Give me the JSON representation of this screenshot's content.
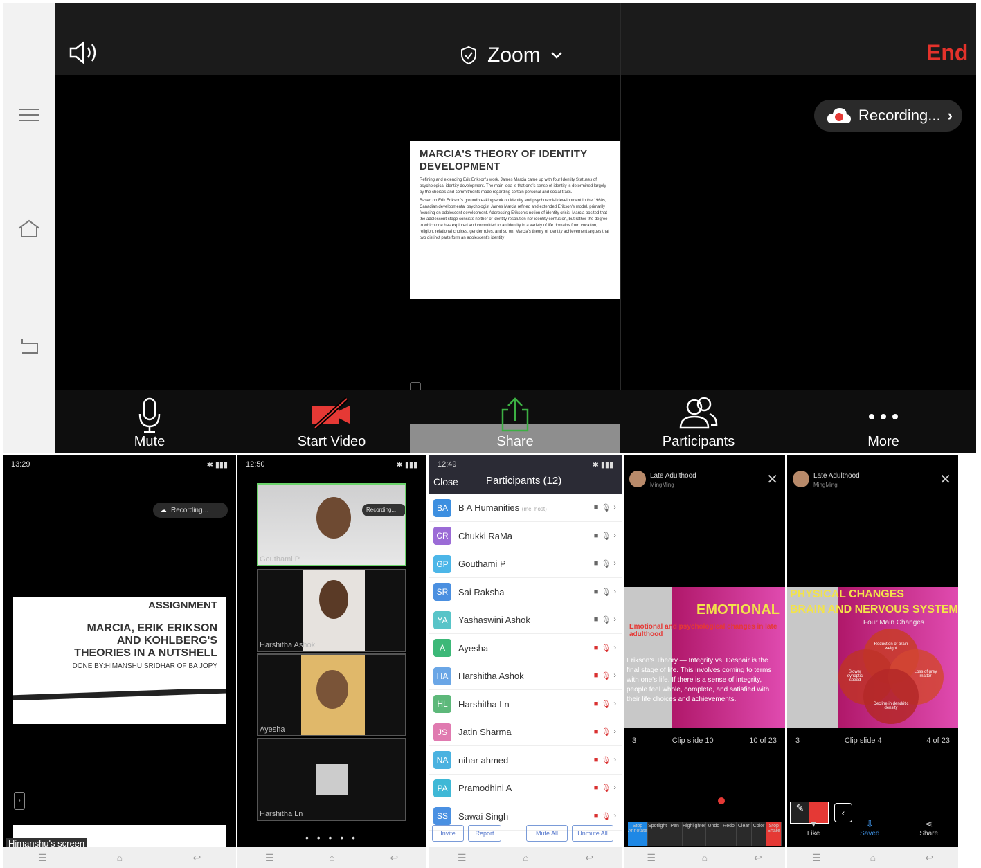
{
  "zoom": {
    "title": "Zoom",
    "end_label": "End",
    "recording_label": "Recording...",
    "shared_doc": {
      "title": "MARCIA'S THEORY OF IDENTITY DEVELOPMENT",
      "para1": "Refining and extending Erik Erikson's work, James Marcia came up with four Identity Statuses of psychological identity development. The main idea is that one's sense of identity is determined largely by the choices and commitments made regarding certain personal and social traits.",
      "para2": "Based on Erik Erikson's groundbreaking work on identity and psychosocial development in the 1960s, Canadian developmental psychologist James Marcia refined and extended Erikson's model, primarily focusing on adolescent development. Addressing Erikson's notion of identity crisis, Marcia posited that the adolescent stage consists neither of identity resolution nor identity confusion, but rather the degree to which one has explored and committed to an identity in a variety of life domains from vocation, religion, relational choices, gender roles, and so on. Marcia's theory of identity achievement argues that two distinct parts form an adolescent's identity"
    },
    "toolbar": {
      "mute": "Mute",
      "start_video": "Start Video",
      "share": "Share",
      "participants": "Participants",
      "more": "More"
    }
  },
  "phone1": {
    "time": "13:29",
    "recording_label": "Recording...",
    "slide_l1": "ASSIGNMENT",
    "slide_l2a": "MARCIA, ERIK ERIKSON",
    "slide_l2b": "AND KOHLBERG'S",
    "slide_l2c": "THEORIES IN A NUTSHELL",
    "slide_l3": "DONE BY:HIMANSHU SRIDHAR OF BA JOPY",
    "screen_label": "Himanshu's screen"
  },
  "phone2": {
    "time": "12:50",
    "recording_label": "Recording...",
    "tiles": [
      "Gouthami P",
      "Harshitha Ashok",
      "Ayesha",
      "Harshitha Ln"
    ]
  },
  "phone3": {
    "time": "12:49",
    "close_label": "Close",
    "title": "Participants (12)",
    "host_tag": "(me, host)",
    "participants": [
      {
        "initials": "BA",
        "name": "B A Humanities",
        "color": "#3d8fe0"
      },
      {
        "initials": "CR",
        "name": "Chukki RaMa",
        "color": "#9b6bd6"
      },
      {
        "initials": "GP",
        "name": "Gouthami P",
        "color": "#4cb6e8"
      },
      {
        "initials": "SR",
        "name": "Sai Raksha",
        "color": "#4a8fe0"
      },
      {
        "initials": "YA",
        "name": "Yashaswini Ashok",
        "color": "#58c4c8"
      },
      {
        "initials": "A",
        "name": "Ayesha",
        "color": "#3cb878"
      },
      {
        "initials": "HA",
        "name": "Harshitha Ashok",
        "color": "#6aa6e6"
      },
      {
        "initials": "HL",
        "name": "Harshitha Ln",
        "color": "#5db87a"
      },
      {
        "initials": "JS",
        "name": "Jatin Sharma",
        "color": "#e07ab0"
      },
      {
        "initials": "NA",
        "name": "nihar ahmed",
        "color": "#4ab2e0"
      },
      {
        "initials": "PA",
        "name": "Pramodhini A",
        "color": "#3fb8d6"
      },
      {
        "initials": "SS",
        "name": "Sawai Singh",
        "color": "#4a90e2"
      }
    ],
    "actions": [
      "Invite",
      "Report",
      "Mute All",
      "Unmute All"
    ]
  },
  "phone4": {
    "title": "Late Adulthood",
    "sub": "MingMing",
    "slide_heading": "EMOTIONAL",
    "slide_line1": "Emotional and psychological changes in late adulthood",
    "slide_text": "Erikson's Theory — Integrity vs. Despair is the final stage of life. This involves coming to terms with one's life. If there is a sense of integrity, people feel whole, complete, and satisfied with their life choices and achievements.",
    "count_left": "3",
    "clip_label": "Clip slide 10",
    "page": "10 of 23",
    "tools": [
      "Stop Annotate",
      "Spotlight",
      "Pen",
      "Highlighter",
      "Undo",
      "Redo",
      "Clear",
      "Color",
      "Stop Share"
    ]
  },
  "phone5": {
    "title": "Late Adulthood",
    "sub": "MingMing",
    "slide_heading1": "PHYSICAL CHANGES",
    "slide_heading2": "BRAIN AND NERVOUS SYSTEM",
    "slide_sub": "Four Main Changes",
    "venn": [
      "Reduction of brain weight",
      "Slower synaptic speed",
      "Loss of grey matter",
      "Decline in dendritic density"
    ],
    "count_left": "3",
    "clip_label": "Clip slide 4",
    "page": "4 of 23",
    "actions": [
      "Like",
      "Saved",
      "Share"
    ]
  }
}
